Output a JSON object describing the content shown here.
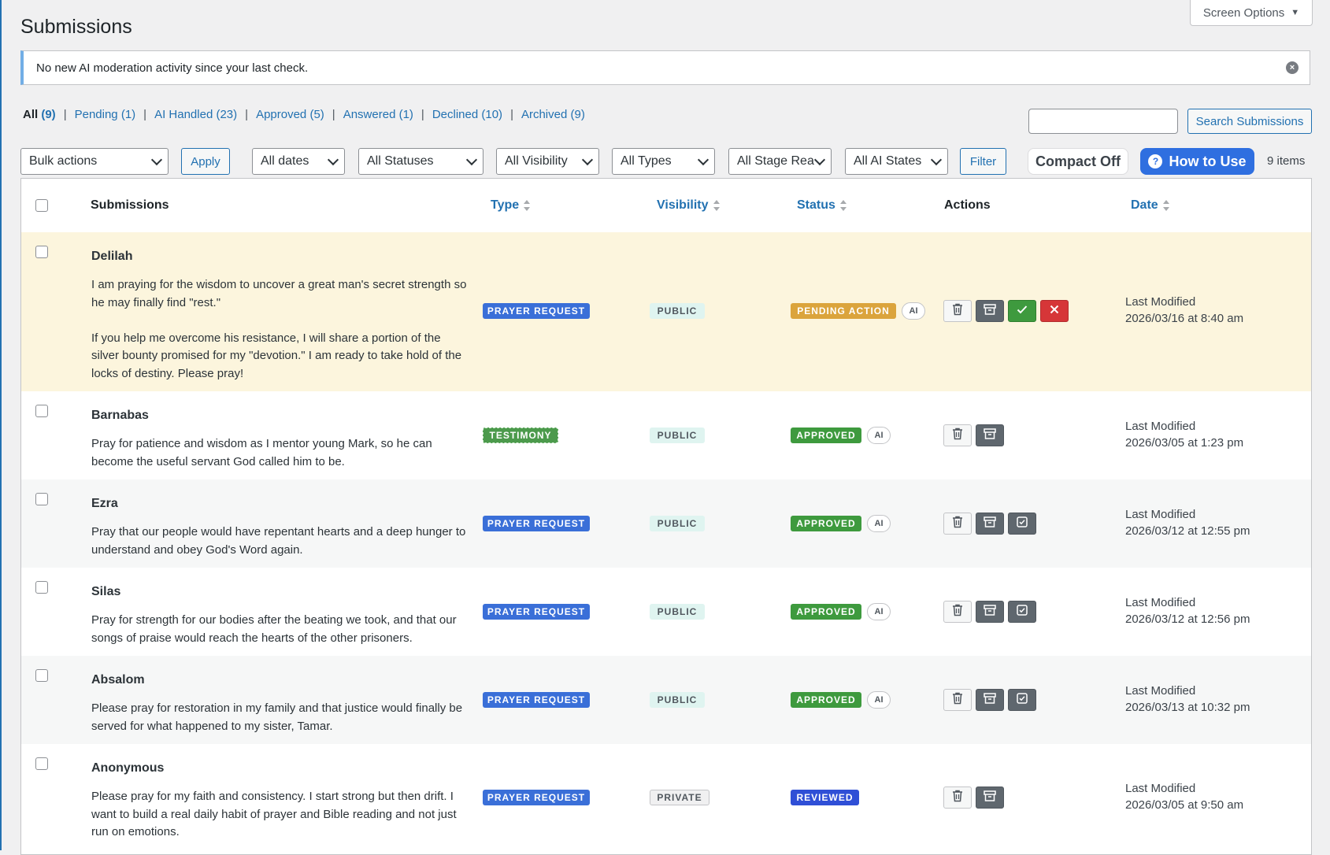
{
  "screen_options": "Screen Options",
  "page_title": "Submissions",
  "notice": "No new AI moderation activity since your last check.",
  "views": [
    {
      "label": "All",
      "count": "(9)"
    },
    {
      "label": "Pending",
      "count": "(1)"
    },
    {
      "label": "AI Handled",
      "count": "(23)"
    },
    {
      "label": "Approved",
      "count": "(5)"
    },
    {
      "label": "Answered",
      "count": "(1)"
    },
    {
      "label": "Declined",
      "count": "(10)"
    },
    {
      "label": "Archived",
      "count": "(9)"
    }
  ],
  "search": {
    "value": "",
    "button": "Search Submissions"
  },
  "filters": {
    "bulk_actions": "Bulk actions",
    "apply": "Apply",
    "dates": "All dates",
    "statuses": "All Statuses",
    "visibility": "All Visibility",
    "types": "All Types",
    "stage": "All Stage Rea",
    "ai_states": "All AI States",
    "filter": "Filter",
    "compact": "Compact Off",
    "how_to": "How to Use",
    "how_to_glyph": "?",
    "items": "9 items"
  },
  "columns": {
    "submissions": "Submissions",
    "type": "Type",
    "visibility": "Visibility",
    "status": "Status",
    "actions": "Actions",
    "date": "Date"
  },
  "ai_label": "AI",
  "date_label": "Last Modified",
  "rows": [
    {
      "name": "Delilah",
      "message": "I am praying for the wisdom to uncover a great man's secret strength so he may finally find \"rest.\"\n\nIf you help me overcome his resistance, I will share a portion of the silver bounty promised for my \"devotion.\" I am ready to take hold of the locks of destiny. Please pray!",
      "type": "PRAYER REQUEST",
      "visibility": "PUBLIC",
      "status": "PENDING ACTION",
      "ai": true,
      "date": "2026/03/16 at 8:40 am"
    },
    {
      "name": "Barnabas",
      "message": "Pray for patience and wisdom as I mentor young Mark, so he can become the useful servant God called him to be.",
      "type": "TESTIMONY",
      "visibility": "PUBLIC",
      "status": "APPROVED",
      "ai": true,
      "date": "2026/03/05 at 1:23 pm"
    },
    {
      "name": "Ezra",
      "message": "Pray that our people would have repentant hearts and a deep hunger to understand and obey God's Word again.",
      "type": "PRAYER REQUEST",
      "visibility": "PUBLIC",
      "status": "APPROVED",
      "ai": true,
      "date": "2026/03/12 at 12:55 pm"
    },
    {
      "name": "Silas",
      "message": "Pray for strength for our bodies after the beating we took, and that our songs of praise would reach the hearts of the other prisoners.",
      "type": "PRAYER REQUEST",
      "visibility": "PUBLIC",
      "status": "APPROVED",
      "ai": true,
      "date": "2026/03/12 at 12:56 pm"
    },
    {
      "name": "Absalom",
      "message": "Please pray for restoration in my family and that justice would finally be served for what happened to my sister, Tamar.",
      "type": "PRAYER REQUEST",
      "visibility": "PUBLIC",
      "status": "APPROVED",
      "ai": true,
      "date": "2026/03/13 at 10:32 pm"
    },
    {
      "name": "Anonymous",
      "message": "Please pray for my faith and consistency. I start strong but then drift. I want to build a real daily habit of prayer and Bible reading and not just run on emotions.",
      "type": "PRAYER REQUEST",
      "visibility": "PRIVATE",
      "status": "REVIEWED",
      "ai": false,
      "date": "2026/03/05 at 9:50 am"
    }
  ],
  "colors": {
    "accent": "#2271b1",
    "pending_row_bg": "#fcf5dd",
    "striped_row_bg": "#f6f7f7"
  }
}
